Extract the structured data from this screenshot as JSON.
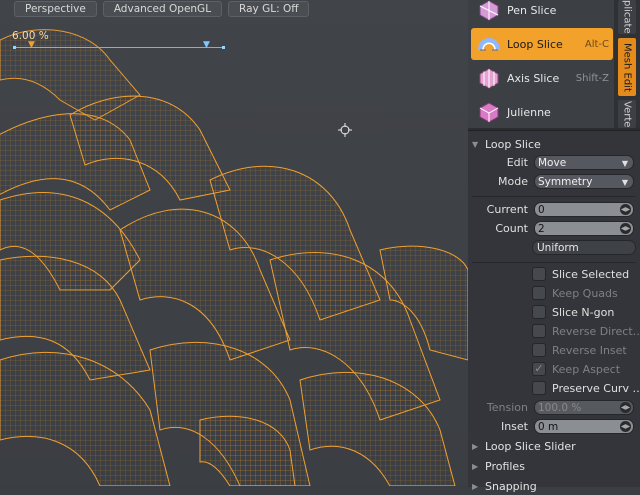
{
  "viewport": {
    "tabs": [
      "Perspective",
      "Advanced OpenGL",
      "Ray GL: Off"
    ],
    "loop_percent": "6.00 %",
    "colors": {
      "wire": "#f0a030",
      "guide": "#c98ad8",
      "handle": "#8fd8ff"
    }
  },
  "tools": [
    {
      "label": "Pen Slice",
      "shortcut": "",
      "icon": "pen-slice-icon",
      "active": false
    },
    {
      "label": "Loop Slice",
      "shortcut": "Alt-C",
      "icon": "loop-slice-icon",
      "active": true
    },
    {
      "label": "Axis Slice",
      "shortcut": "Shift-Z",
      "icon": "axis-slice-icon",
      "active": false
    },
    {
      "label": "Julienne",
      "shortcut": "",
      "icon": "julienne-icon",
      "active": false
    }
  ],
  "side_tabs": [
    "plicate",
    "Mesh Edit",
    "Verte"
  ],
  "properties": {
    "section_title": "Loop Slice",
    "edit": {
      "label": "Edit",
      "value": "Move"
    },
    "mode": {
      "label": "Mode",
      "value": "Symmetry"
    },
    "current": {
      "label": "Current",
      "value": "0"
    },
    "count": {
      "label": "Count",
      "value": "2"
    },
    "uniform_button": "Uniform",
    "checkboxes": [
      {
        "label": "Slice Selected",
        "checked": false,
        "enabled": true
      },
      {
        "label": "Keep Quads",
        "checked": false,
        "enabled": false
      },
      {
        "label": "Slice N-gon",
        "checked": false,
        "enabled": true
      },
      {
        "label": "Reverse Direct…",
        "checked": false,
        "enabled": false
      },
      {
        "label": "Reverse Inset",
        "checked": false,
        "enabled": false
      },
      {
        "label": "Keep Aspect",
        "checked": true,
        "enabled": false
      },
      {
        "label": "Preserve Curv …",
        "checked": false,
        "enabled": true
      }
    ],
    "tension": {
      "label": "Tension",
      "value": "100.0 %"
    },
    "inset": {
      "label": "Inset",
      "value": "0 m"
    },
    "collapsed_sections": [
      "Loop Slice Slider",
      "Profiles",
      "Snapping"
    ],
    "accent": "#f2a12b"
  }
}
